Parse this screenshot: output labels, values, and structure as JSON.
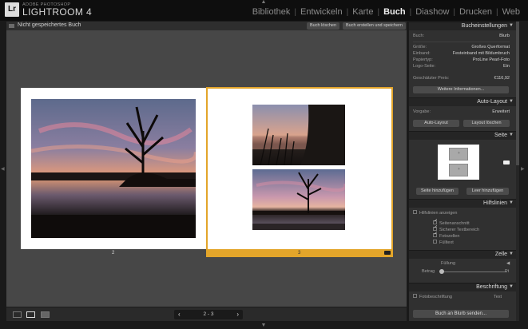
{
  "topbar": {
    "logo": "Lr",
    "brand_small": "ADOBE PHOTOSHOP",
    "brand_name": "LIGHTROOM 4",
    "modules": [
      "Bibliothek",
      "Entwickeln",
      "Karte",
      "Buch",
      "Diashow",
      "Drucken",
      "Web"
    ],
    "active_module": "Buch"
  },
  "doc": {
    "title": "Nicht gespeichertes Buch",
    "btn_clear": "Buch löschen",
    "btn_create": "Buch erstellen und speichern"
  },
  "pages": {
    "left_number": "2",
    "right_number": "3"
  },
  "toolbar": {
    "pager_label": "2 - 3",
    "prev": "‹",
    "next": "›"
  },
  "panels": {
    "book_settings": {
      "title": "Bucheinstellungen",
      "book_label": "Buch:",
      "book_value": "Blurb",
      "rows": [
        {
          "k": "Größe:",
          "v": "Großes Querformat"
        },
        {
          "k": "Einband:",
          "v": "Festeinband mit Bildumbruch"
        },
        {
          "k": "Papiertyp:",
          "v": "ProLine Pearl-Foto"
        },
        {
          "k": "Logo-Seite:",
          "v": "Ein"
        }
      ],
      "price_label": "Geschätzter Preis:",
      "price_value": "€116,92",
      "more_info": "Weitere Informationen..."
    },
    "auto_layout": {
      "title": "Auto-Layout",
      "preset_label": "Vorgabe:",
      "preset_value": "Erweitert",
      "btn_auto": "Auto-Layout",
      "btn_clear": "Layout löschen"
    },
    "page": {
      "title": "Seite",
      "btn_add_page": "Seite hinzufügen",
      "btn_add_blank": "Leer hinzufügen"
    },
    "guides": {
      "title": "Hilfslinien",
      "show_label": "Hilfslinien anzeigen",
      "items": [
        {
          "label": "Seitenanschnitt",
          "checked": true
        },
        {
          "label": "Sicherer Textbereich",
          "checked": true
        },
        {
          "label": "Fotozellen",
          "checked": true
        },
        {
          "label": "Fülltext",
          "checked": false
        }
      ]
    },
    "cell": {
      "title": "Zelle",
      "fill_label": "Füllung",
      "amount_label": "Betrag",
      "unit": "Pt"
    },
    "caption": {
      "title": "Beschriftung",
      "photo_caption_label": "Fotobeschriftung",
      "photo_caption_value": "Text"
    },
    "send_button": "Buch an Blurb senden..."
  },
  "colors": {
    "selection": "#e3a52a",
    "panel_bg": "#303030",
    "canvas_bg": "#474747"
  }
}
